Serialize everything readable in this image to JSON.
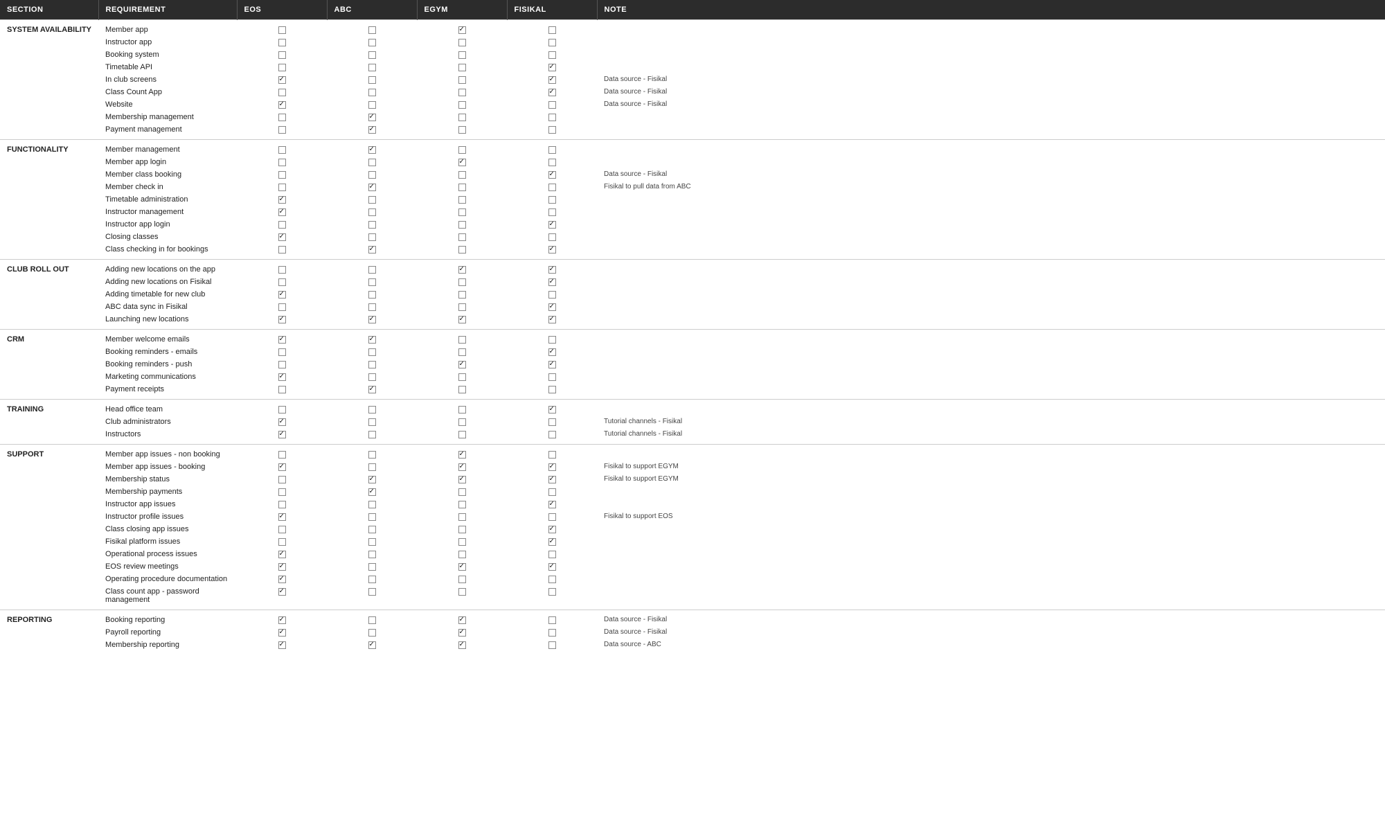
{
  "headers": {
    "section": "SECTION",
    "requirement": "REQUIREMENT",
    "eos": "EOS",
    "abc": "ABC",
    "egym": "EGYM",
    "fisikal": "FISIKAL",
    "note": "NOTE"
  },
  "sections": [
    {
      "label": "SYSTEM AVAILABILITY",
      "rows": [
        {
          "req": "Member app",
          "eos": false,
          "abc": false,
          "egym": true,
          "fisikal": false,
          "note": ""
        },
        {
          "req": "Instructor app",
          "eos": false,
          "abc": false,
          "egym": false,
          "fisikal": false,
          "note": ""
        },
        {
          "req": "Booking system",
          "eos": false,
          "abc": false,
          "egym": false,
          "fisikal": false,
          "note": ""
        },
        {
          "req": "Timetable API",
          "eos": false,
          "abc": false,
          "egym": false,
          "fisikal": true,
          "note": ""
        },
        {
          "req": "In club screens",
          "eos": true,
          "abc": false,
          "egym": false,
          "fisikal": true,
          "note": "Data source - Fisikal"
        },
        {
          "req": "Class Count App",
          "eos": false,
          "abc": false,
          "egym": false,
          "fisikal": true,
          "note": "Data source - Fisikal"
        },
        {
          "req": "Website",
          "eos": true,
          "abc": false,
          "egym": false,
          "fisikal": false,
          "note": "Data source - Fisikal"
        },
        {
          "req": "Membership management",
          "eos": false,
          "abc": true,
          "egym": false,
          "fisikal": false,
          "note": ""
        },
        {
          "req": "Payment management",
          "eos": false,
          "abc": true,
          "egym": false,
          "fisikal": false,
          "note": ""
        }
      ]
    },
    {
      "label": "FUNCTIONALITY",
      "rows": [
        {
          "req": "Member management",
          "eos": false,
          "abc": true,
          "egym": false,
          "fisikal": false,
          "note": ""
        },
        {
          "req": "Member app login",
          "eos": false,
          "abc": false,
          "egym": true,
          "fisikal": false,
          "note": ""
        },
        {
          "req": "Member class booking",
          "eos": false,
          "abc": false,
          "egym": false,
          "fisikal": true,
          "note": "Data source - Fisikal"
        },
        {
          "req": "Member check in",
          "eos": false,
          "abc": true,
          "egym": false,
          "fisikal": false,
          "note": "Fisikal to pull data from ABC"
        },
        {
          "req": "Timetable administration",
          "eos": true,
          "abc": false,
          "egym": false,
          "fisikal": false,
          "note": ""
        },
        {
          "req": "Instructor management",
          "eos": true,
          "abc": false,
          "egym": false,
          "fisikal": false,
          "note": ""
        },
        {
          "req": "Instructor app login",
          "eos": false,
          "abc": false,
          "egym": false,
          "fisikal": true,
          "note": ""
        },
        {
          "req": "Closing classes",
          "eos": true,
          "abc": false,
          "egym": false,
          "fisikal": false,
          "note": ""
        },
        {
          "req": "Class checking in for bookings",
          "eos": false,
          "abc": true,
          "egym": false,
          "fisikal": true,
          "note": ""
        }
      ]
    },
    {
      "label": "CLUB ROLL OUT",
      "rows": [
        {
          "req": "Adding new locations on the app",
          "eos": false,
          "abc": false,
          "egym": true,
          "fisikal": true,
          "note": ""
        },
        {
          "req": "Adding new locations on Fisikal",
          "eos": false,
          "abc": false,
          "egym": false,
          "fisikal": true,
          "note": ""
        },
        {
          "req": "Adding timetable for new club",
          "eos": true,
          "abc": false,
          "egym": false,
          "fisikal": false,
          "note": ""
        },
        {
          "req": "ABC data sync in Fisikal",
          "eos": false,
          "abc": false,
          "egym": false,
          "fisikal": true,
          "note": ""
        },
        {
          "req": "Launching new locations",
          "eos": true,
          "abc": true,
          "egym": true,
          "fisikal": true,
          "note": ""
        }
      ]
    },
    {
      "label": "CRM",
      "rows": [
        {
          "req": "Member welcome emails",
          "eos": true,
          "abc": true,
          "egym": false,
          "fisikal": false,
          "note": ""
        },
        {
          "req": "Booking reminders - emails",
          "eos": false,
          "abc": false,
          "egym": false,
          "fisikal": true,
          "note": ""
        },
        {
          "req": "Booking reminders - push",
          "eos": false,
          "abc": false,
          "egym": true,
          "fisikal": true,
          "note": ""
        },
        {
          "req": "Marketing communications",
          "eos": true,
          "abc": false,
          "egym": false,
          "fisikal": false,
          "note": ""
        },
        {
          "req": "Payment receipts",
          "eos": false,
          "abc": true,
          "egym": false,
          "fisikal": false,
          "note": ""
        }
      ]
    },
    {
      "label": "TRAINING",
      "rows": [
        {
          "req": "Head office team",
          "eos": false,
          "abc": false,
          "egym": false,
          "fisikal": true,
          "note": ""
        },
        {
          "req": "Club administrators",
          "eos": true,
          "abc": false,
          "egym": false,
          "fisikal": false,
          "note": "Tutorial channels - Fisikal"
        },
        {
          "req": "Instructors",
          "eos": true,
          "abc": false,
          "egym": false,
          "fisikal": false,
          "note": "Tutorial channels - Fisikal"
        }
      ]
    },
    {
      "label": "SUPPORT",
      "rows": [
        {
          "req": "Member app issues - non booking",
          "eos": false,
          "abc": false,
          "egym": true,
          "fisikal": false,
          "note": ""
        },
        {
          "req": "Member app issues - booking",
          "eos": true,
          "abc": false,
          "egym": true,
          "fisikal": true,
          "note": "Fisikal to support EGYM"
        },
        {
          "req": "Membership status",
          "eos": false,
          "abc": true,
          "egym": true,
          "fisikal": true,
          "note": "Fisikal to support EGYM"
        },
        {
          "req": "Membership payments",
          "eos": false,
          "abc": true,
          "egym": false,
          "fisikal": false,
          "note": ""
        },
        {
          "req": "Instructor app issues",
          "eos": false,
          "abc": false,
          "egym": false,
          "fisikal": true,
          "note": ""
        },
        {
          "req": "Instructor profile issues",
          "eos": true,
          "abc": false,
          "egym": false,
          "fisikal": false,
          "note": "Fisikal to support EOS"
        },
        {
          "req": "Class closing app issues",
          "eos": false,
          "abc": false,
          "egym": false,
          "fisikal": true,
          "note": ""
        },
        {
          "req": "Fisikal platform issues",
          "eos": false,
          "abc": false,
          "egym": false,
          "fisikal": true,
          "note": ""
        },
        {
          "req": "Operational process issues",
          "eos": true,
          "abc": false,
          "egym": false,
          "fisikal": false,
          "note": ""
        },
        {
          "req": "EOS review meetings",
          "eos": true,
          "abc": false,
          "egym": true,
          "fisikal": true,
          "note": ""
        },
        {
          "req": "Operating procedure documentation",
          "eos": true,
          "abc": false,
          "egym": false,
          "fisikal": false,
          "note": ""
        },
        {
          "req": "Class count app - password management",
          "eos": true,
          "abc": false,
          "egym": false,
          "fisikal": false,
          "note": ""
        }
      ]
    },
    {
      "label": "REPORTING",
      "rows": [
        {
          "req": "Booking reporting",
          "eos": true,
          "abc": false,
          "egym": true,
          "fisikal": false,
          "note": "Data source - Fisikal"
        },
        {
          "req": "Payroll reporting",
          "eos": true,
          "abc": false,
          "egym": true,
          "fisikal": false,
          "note": "Data source - Fisikal"
        },
        {
          "req": "Membership reporting",
          "eos": true,
          "abc": true,
          "egym": true,
          "fisikal": false,
          "note": "Data source - ABC"
        }
      ]
    }
  ]
}
